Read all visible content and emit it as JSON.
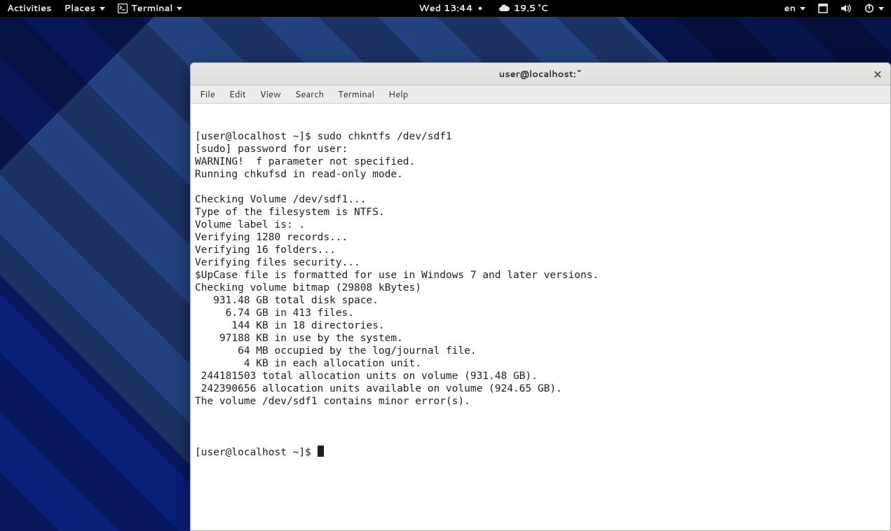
{
  "topbar": {
    "activities": "Activities",
    "places": "Places",
    "terminal": "Terminal",
    "clock": "Wed 13:44",
    "weather_temp": "19.5 °C",
    "lang": "en"
  },
  "window": {
    "title": "user@localhost:~"
  },
  "menubar": {
    "items": [
      "File",
      "Edit",
      "View",
      "Search",
      "Terminal",
      "Help"
    ]
  },
  "terminal": {
    "lines": [
      "[user@localhost ~]$ sudo chkntfs /dev/sdf1",
      "[sudo] password for user: ",
      "WARNING!  f parameter not specified.",
      "Running chkufsd in read-only mode.",
      "",
      "Checking Volume /dev/sdf1...",
      "Type of the filesystem is NTFS.",
      "Volume label is: .",
      "Verifying 1280 records...",
      "Verifying 16 folders...",
      "Verifying files security...",
      "$UpCase file is formatted for use in Windows 7 and later versions.",
      "Checking volume bitmap (29808 kBytes)",
      "   931.48 GB total disk space.",
      "     6.74 GB in 413 files.",
      "      144 KB in 18 directories.",
      "    97188 KB in use by the system.",
      "       64 MB occupied by the log/journal file.",
      "        4 KB in each allocation unit.",
      " 244181503 total allocation units on volume (931.48 GB).",
      " 242390656 allocation units available on volume (924.65 GB).",
      "The volume /dev/sdf1 contains minor error(s).",
      ""
    ],
    "prompt": "[user@localhost ~]$ "
  }
}
